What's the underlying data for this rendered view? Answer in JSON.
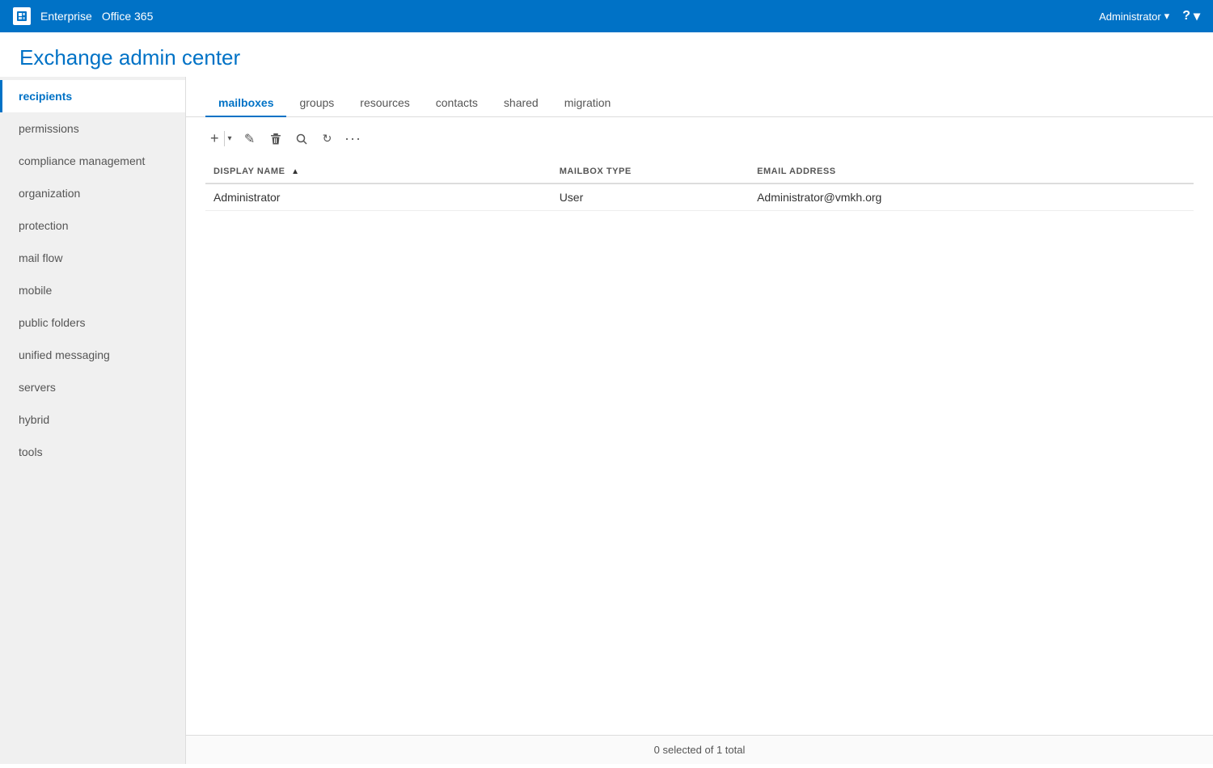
{
  "topbar": {
    "logo_alt": "Office logo",
    "product1": "Enterprise",
    "product2": "Office 365",
    "user": "Administrator",
    "help": "?"
  },
  "page": {
    "title": "Exchange admin center"
  },
  "sidebar": {
    "items": [
      {
        "id": "recipients",
        "label": "recipients",
        "active": true
      },
      {
        "id": "permissions",
        "label": "permissions",
        "active": false
      },
      {
        "id": "compliance-management",
        "label": "compliance management",
        "active": false
      },
      {
        "id": "organization",
        "label": "organization",
        "active": false
      },
      {
        "id": "protection",
        "label": "protection",
        "active": false
      },
      {
        "id": "mail-flow",
        "label": "mail flow",
        "active": false
      },
      {
        "id": "mobile",
        "label": "mobile",
        "active": false
      },
      {
        "id": "public-folders",
        "label": "public folders",
        "active": false
      },
      {
        "id": "unified-messaging",
        "label": "unified messaging",
        "active": false
      },
      {
        "id": "servers",
        "label": "servers",
        "active": false
      },
      {
        "id": "hybrid",
        "label": "hybrid",
        "active": false
      },
      {
        "id": "tools",
        "label": "tools",
        "active": false
      }
    ]
  },
  "tabs": [
    {
      "id": "mailboxes",
      "label": "mailboxes",
      "active": true
    },
    {
      "id": "groups",
      "label": "groups",
      "active": false
    },
    {
      "id": "resources",
      "label": "resources",
      "active": false
    },
    {
      "id": "contacts",
      "label": "contacts",
      "active": false
    },
    {
      "id": "shared",
      "label": "shared",
      "active": false
    },
    {
      "id": "migration",
      "label": "migration",
      "active": false
    }
  ],
  "toolbar": {
    "add_label": "+",
    "dropdown_label": "▾",
    "edit_icon": "✎",
    "delete_icon": "🗑",
    "search_icon": "🔍",
    "refresh_icon": "↻",
    "more_icon": "···"
  },
  "table": {
    "columns": [
      {
        "id": "display-name",
        "label": "DISPLAY NAME",
        "sortable": true,
        "sorted": true
      },
      {
        "id": "mailbox-type",
        "label": "MAILBOX TYPE",
        "sortable": false
      },
      {
        "id": "email-address",
        "label": "EMAIL ADDRESS",
        "sortable": false
      }
    ],
    "rows": [
      {
        "display_name": "Administrator",
        "mailbox_type": "User",
        "email_address": "Administrator@vmkh.org"
      }
    ]
  },
  "statusbar": {
    "text": "0 selected of 1 total"
  }
}
